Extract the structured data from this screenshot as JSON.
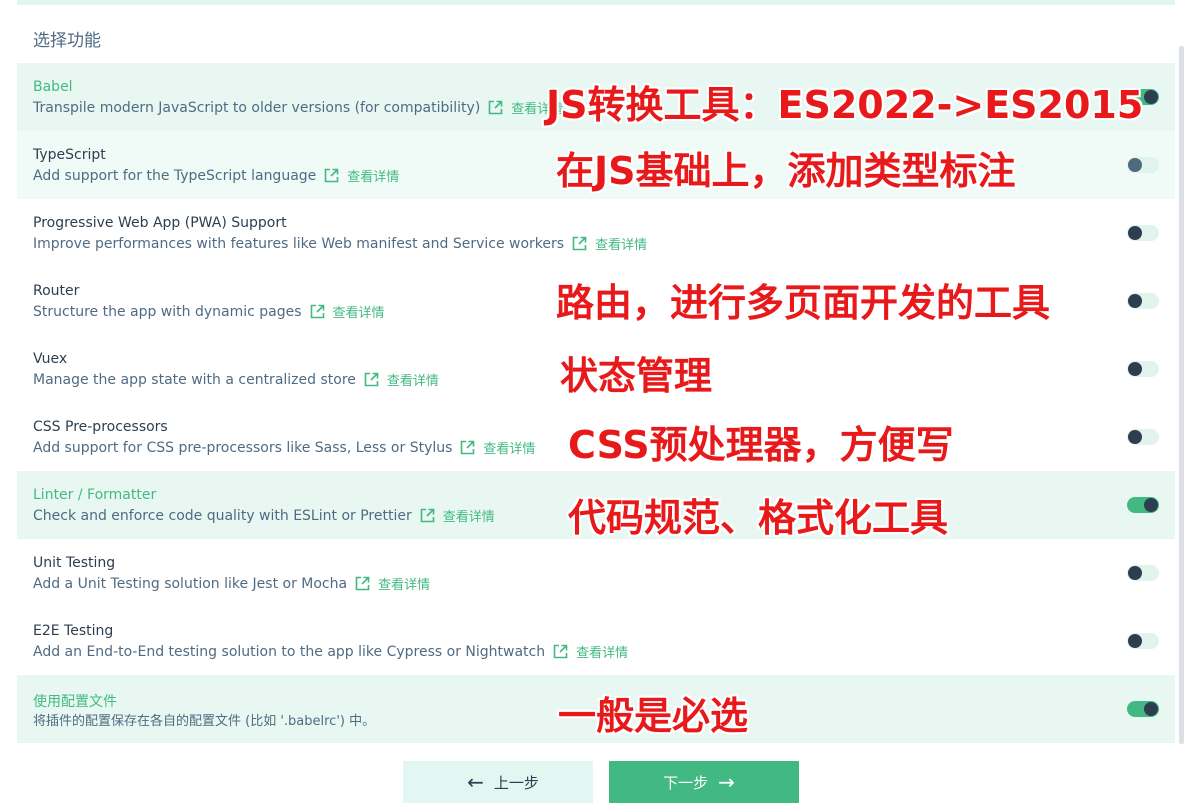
{
  "section_title": "选择功能",
  "details_label": "查看详情",
  "features": [
    {
      "title": "Babel",
      "description": "Transpile modern JavaScript to older versions (for compatibility)",
      "enabled": true,
      "has_link": true
    },
    {
      "title": "TypeScript",
      "description": "Add support for the TypeScript language",
      "enabled": false,
      "has_link": true
    },
    {
      "title": "Progressive Web App (PWA) Support",
      "description": "Improve performances with features like Web manifest and Service workers",
      "enabled": false,
      "has_link": true
    },
    {
      "title": "Router",
      "description": "Structure the app with dynamic pages",
      "enabled": false,
      "has_link": true
    },
    {
      "title": "Vuex",
      "description": "Manage the app state with a centralized store",
      "enabled": false,
      "has_link": true
    },
    {
      "title": "CSS Pre-processors",
      "description": "Add support for CSS pre-processors like Sass, Less or Stylus",
      "enabled": false,
      "has_link": true
    },
    {
      "title": "Linter / Formatter",
      "description": "Check and enforce code quality with ESLint or Prettier",
      "enabled": true,
      "has_link": true
    },
    {
      "title": "Unit Testing",
      "description": "Add a Unit Testing solution like Jest or Mocha",
      "enabled": false,
      "has_link": true
    },
    {
      "title": "E2E Testing",
      "description": "Add an End-to-End testing solution to the app like Cypress or Nightwatch",
      "enabled": false,
      "has_link": true
    },
    {
      "title": "使用配置文件",
      "description": "将插件的配置保存在各自的配置文件 (比如 '.babelrc') 中。",
      "enabled": true,
      "has_link": false
    }
  ],
  "annotations": [
    "JS转换工具：ES2022->ES2015",
    "在JS基础上，添加类型标注",
    "路由，进行多页面开发的工具",
    "状态管理",
    "CSS预处理器，方便写",
    "代码规范、格式化工具",
    "一般是必选"
  ],
  "buttons": {
    "prev": "上一步",
    "next": "下一步"
  },
  "icons": {
    "prev": "arrow-left-icon",
    "next": "arrow-right-icon",
    "link": "external-link-icon"
  },
  "colors": {
    "accent": "#42b983",
    "text": "#2c3e50",
    "muted": "#4f6b84",
    "annotation": "#e8191b"
  }
}
